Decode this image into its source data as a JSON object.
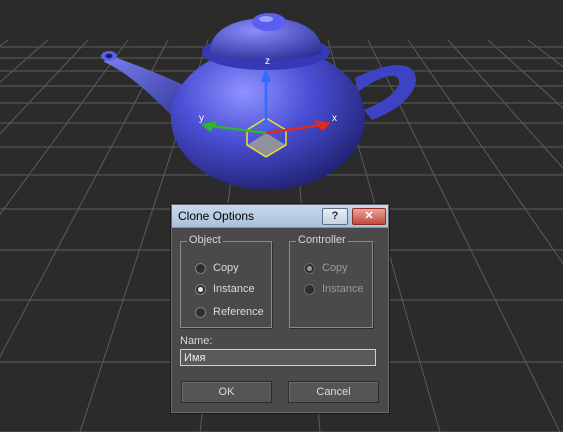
{
  "viewport": {
    "gizmo_labels": {
      "x": "x",
      "y": "y",
      "z": "z"
    },
    "colors": {
      "background": "#2b2b2b",
      "grid": "#5c5c5c",
      "teapot": "#4b4fd6"
    }
  },
  "dialog": {
    "title": "Clone Options",
    "help_glyph": "?",
    "close_glyph": "✕",
    "object_group": {
      "label": "Object",
      "options": [
        {
          "label": "Copy",
          "selected": false
        },
        {
          "label": "Instance",
          "selected": true
        },
        {
          "label": "Reference",
          "selected": false
        }
      ]
    },
    "controller_group": {
      "label": "Controller",
      "enabled": false,
      "options": [
        {
          "label": "Copy",
          "selected": true
        },
        {
          "label": "Instance",
          "selected": false
        }
      ]
    },
    "name_label": "Name:",
    "name_value": "Имя",
    "ok_label": "OK",
    "cancel_label": "Cancel"
  }
}
